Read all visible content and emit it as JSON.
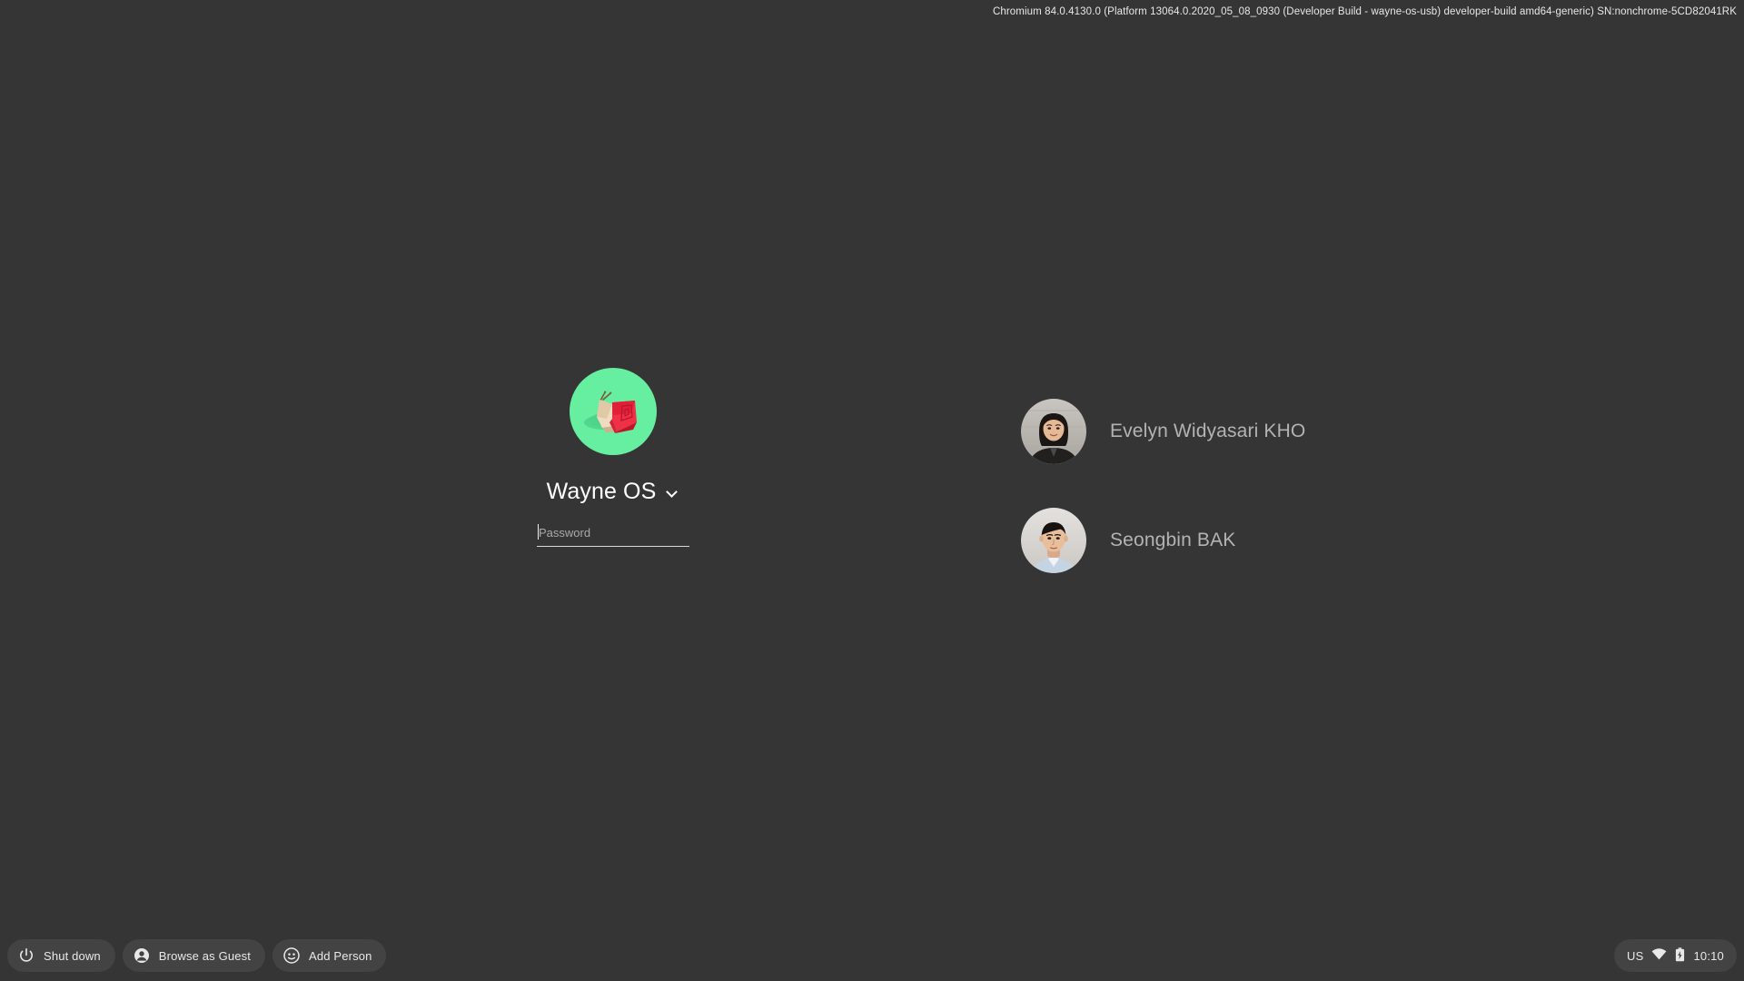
{
  "system": {
    "version_string": "Chromium 84.0.4130.0 (Platform 13064.0.2020_05_08_0930 (Developer Build - wayne-os-usb) developer-build amd64-generic) SN:nonchrome-5CD82041RK",
    "background_color": "#353535"
  },
  "primary_pod": {
    "avatar_icon": "origami-snail-avatar",
    "avatar_background_color": "#66efa0",
    "avatar_shell_color": "#e8273f",
    "avatar_body_color": "#e8d3b4",
    "display_name": "Wayne OS",
    "dropdown_icon": "chevron-down-icon",
    "password": {
      "value": "",
      "placeholder": "Password"
    }
  },
  "other_users": [
    {
      "name": "Evelyn Widyasari KHO",
      "avatar_icon": "user-photo-avatar"
    },
    {
      "name": "Seongbin BAK",
      "avatar_icon": "user-photo-avatar"
    }
  ],
  "shelf": {
    "buttons": [
      {
        "label": "Shut down",
        "icon": "power-icon"
      },
      {
        "label": "Browse as Guest",
        "icon": "person-icon"
      },
      {
        "label": "Add Person",
        "icon": "add-person-icon"
      }
    ]
  },
  "status_tray": {
    "keyboard_layout": "US",
    "network_icon": "wifi-icon",
    "battery_icon": "battery-charging-icon",
    "time": "10:10"
  }
}
